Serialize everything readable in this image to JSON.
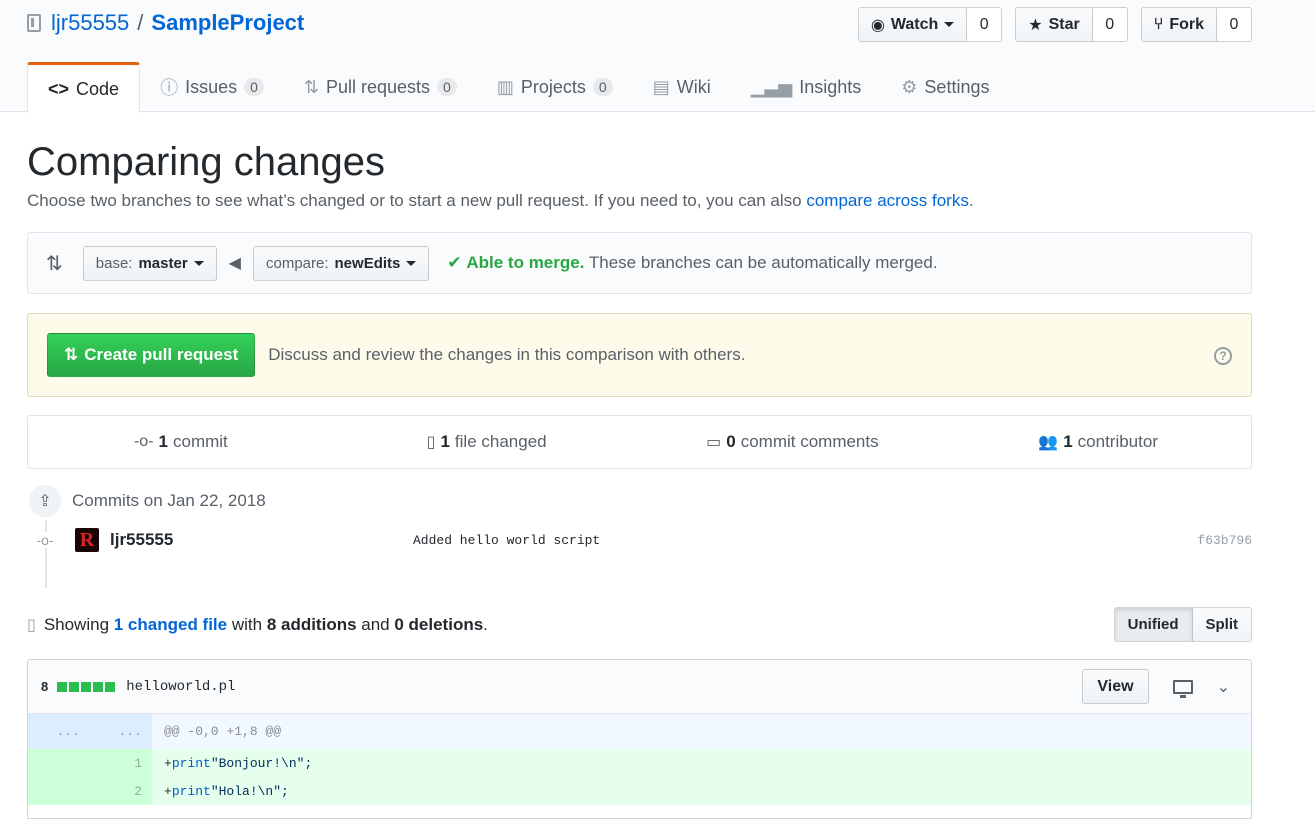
{
  "repo": {
    "owner": "ljr55555",
    "separator": "/",
    "name": "SampleProject"
  },
  "actions": [
    {
      "icon": "eye-icon",
      "label": "Watch",
      "count": "0"
    },
    {
      "icon": "star-icon",
      "label": "Star",
      "count": "0"
    },
    {
      "icon": "fork-icon",
      "label": "Fork",
      "count": "0"
    }
  ],
  "nav": {
    "code": "Code",
    "issues": "Issues",
    "issues_count": "0",
    "pulls": "Pull requests",
    "pulls_count": "0",
    "projects": "Projects",
    "projects_count": "0",
    "wiki": "Wiki",
    "insights": "Insights",
    "settings": "Settings"
  },
  "page": {
    "title": "Comparing changes",
    "subtitle": "Choose two branches to see what’s changed or to start a new pull request. If you need to, you can also ",
    "subtitle_link": "compare across forks",
    "subtitle_end": "."
  },
  "range": {
    "base_label": "base:",
    "base_branch": "master",
    "compare_label": "compare:",
    "compare_branch": "newEdits",
    "merge_ok": "Able to merge.",
    "merge_text": " These branches can be automatically merged."
  },
  "pr": {
    "button": "Create pull request",
    "text": "Discuss and review the changes in this comparison with others.",
    "help": "?"
  },
  "summary": {
    "commits_num": "1",
    "commits_label": "commit",
    "files_num": "1",
    "files_label": "file changed",
    "comments_num": "0",
    "comments_label": "commit comments",
    "contributors_num": "1",
    "contributors_label": "contributor"
  },
  "commits": {
    "group_title": "Commits on Jan 22, 2018",
    "items": [
      {
        "author": "ljr55555",
        "avatar_letter": "R",
        "message": "Added hello world script",
        "sha": "f63b796"
      }
    ]
  },
  "toc": {
    "showing": "Showing ",
    "changed_link": "1 changed file",
    "with": " with ",
    "additions": "8 additions",
    "and": " and ",
    "deletions": "0 deletions",
    "end": ".",
    "unified": "Unified",
    "split": "Split"
  },
  "file": {
    "additions_count": "8",
    "name": "helloworld.pl",
    "view": "View",
    "hunk_left": "...",
    "hunk_right": "...",
    "hunk_header": "@@ -0,0 +1,8 @@",
    "lines": [
      {
        "num": "1",
        "plus": "+",
        "kw": "print",
        "str": " \"Bonjour!\\n\";"
      },
      {
        "num": "2",
        "plus": "+",
        "kw": "print",
        "str": " \"Hola!\\n\";"
      }
    ]
  }
}
